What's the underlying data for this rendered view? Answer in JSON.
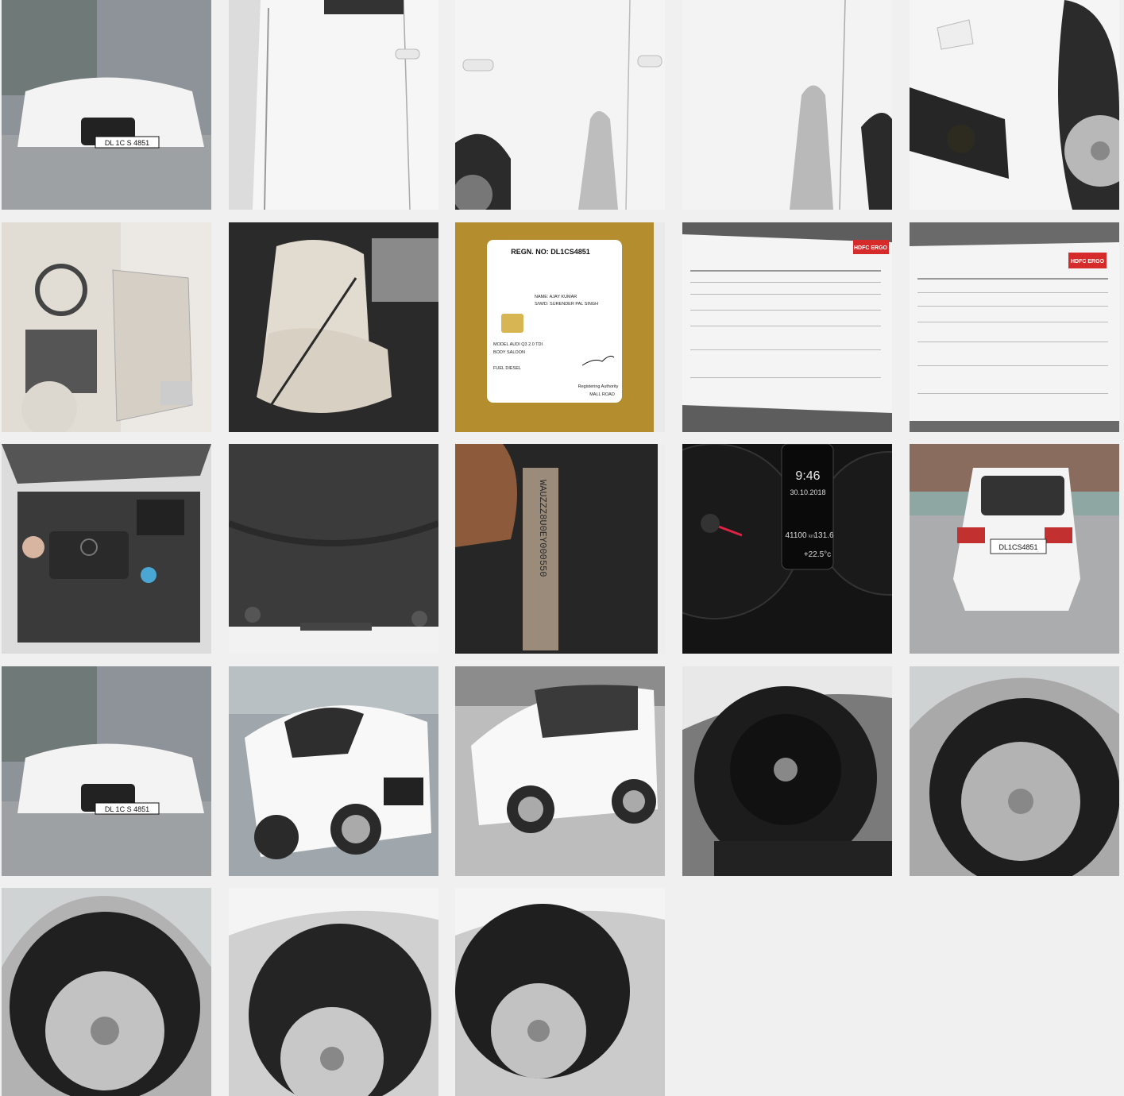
{
  "gallery": {
    "photos": [
      {
        "subject": "front-view-audi",
        "plate": "DL 1C S 4851",
        "colors": {
          "bg": "#8a8f95",
          "body": "#f2f2f2"
        }
      },
      {
        "subject": "side-door-panel",
        "colors": {
          "bg": "#d8d8d8",
          "body": "#f6f6f6"
        }
      },
      {
        "subject": "side-door-shadow",
        "colors": {
          "bg": "#cfcfcf",
          "body": "#f4f4f4"
        }
      },
      {
        "subject": "rear-door-shadow",
        "colors": {
          "bg": "#d2d2d2",
          "body": "#f3f3f3"
        }
      },
      {
        "subject": "front-bumper-fog-lamp",
        "colors": {
          "bg": "#cccccc",
          "body": "#f5f5f5"
        }
      },
      {
        "subject": "interior-dashboard-door",
        "colors": {
          "bg": "#e6e3dd",
          "body": "#d8d2c7"
        }
      },
      {
        "subject": "interior-seat",
        "colors": {
          "bg": "#2a2a2a",
          "body": "#e2dbcf"
        }
      },
      {
        "subject": "registration-card",
        "colors": {
          "bg": "#b08a2a",
          "body": "#ffffff"
        },
        "card": {
          "title": "REGN. NO: DL1CS4851",
          "owner": "NAME: AJAY KUMAR",
          "relation": "S/W/D: SURENDER PAL SINGH",
          "model": "MODEL  AUDI Q3 2.0 TDI",
          "body": "BODY  SALOON",
          "fuel": "FUEL  DIESEL",
          "authority": "Registering Authority",
          "office": "MALL ROAD"
        }
      },
      {
        "subject": "insurance-policy-1",
        "brand": "HDFC ERGO",
        "colors": {
          "bg": "#5a5a5a",
          "body": "#f4f4f4",
          "brand": "#d62b2b"
        }
      },
      {
        "subject": "insurance-policy-2",
        "brand": "HDFC ERGO",
        "colors": {
          "bg": "#6a6a6a",
          "body": "#f4f4f4",
          "brand": "#d62b2b"
        }
      },
      {
        "subject": "engine-bay",
        "colors": {
          "bg": "#3a3a3a",
          "body": "#555555"
        }
      },
      {
        "subject": "underbody",
        "colors": {
          "bg": "#2e2e2e",
          "body": "#444444"
        }
      },
      {
        "subject": "chassis-number",
        "vin": "WAUZZZ8U0EY000550",
        "colors": {
          "bg": "#222222",
          "body": "#9b8b7a"
        }
      },
      {
        "subject": "instrument-cluster",
        "cluster": {
          "time": "9:46",
          "date": "30.10.2018",
          "odometer": "41100",
          "unit": "km",
          "trip": "131.6",
          "temp": "+22.5°c"
        },
        "colors": {
          "bg": "#151515",
          "body": "#0c0c0c"
        }
      },
      {
        "subject": "rear-view-audi",
        "plate": "DL1CS4851",
        "colors": {
          "bg": "#a7a9aa",
          "body": "#f4f4f4"
        }
      },
      {
        "subject": "front-view-audi-2",
        "plate": "DL 1C S 4851",
        "colors": {
          "bg": "#8a8f95",
          "body": "#f2f2f2"
        }
      },
      {
        "subject": "front-quarter-view",
        "colors": {
          "bg": "#9fa6ab",
          "body": "#f7f7f7"
        }
      },
      {
        "subject": "side-quarter-view",
        "colors": {
          "bg": "#b9b9b9",
          "body": "#f7f7f7"
        }
      },
      {
        "subject": "spare-wheel",
        "colors": {
          "bg": "#7a7a7a",
          "body": "#1a1a1a"
        }
      },
      {
        "subject": "front-tyre-1",
        "colors": {
          "bg": "#a9a9a9",
          "body": "#1e1e1e"
        }
      },
      {
        "subject": "rear-tyre-1",
        "colors": {
          "bg": "#b2b2b2",
          "body": "#202020"
        }
      },
      {
        "subject": "rear-tyre-2",
        "colors": {
          "bg": "#cfcfcf",
          "body": "#242424"
        }
      },
      {
        "subject": "rear-tyre-3",
        "colors": {
          "bg": "#c9c9c9",
          "body": "#1f1f1f"
        }
      }
    ]
  }
}
